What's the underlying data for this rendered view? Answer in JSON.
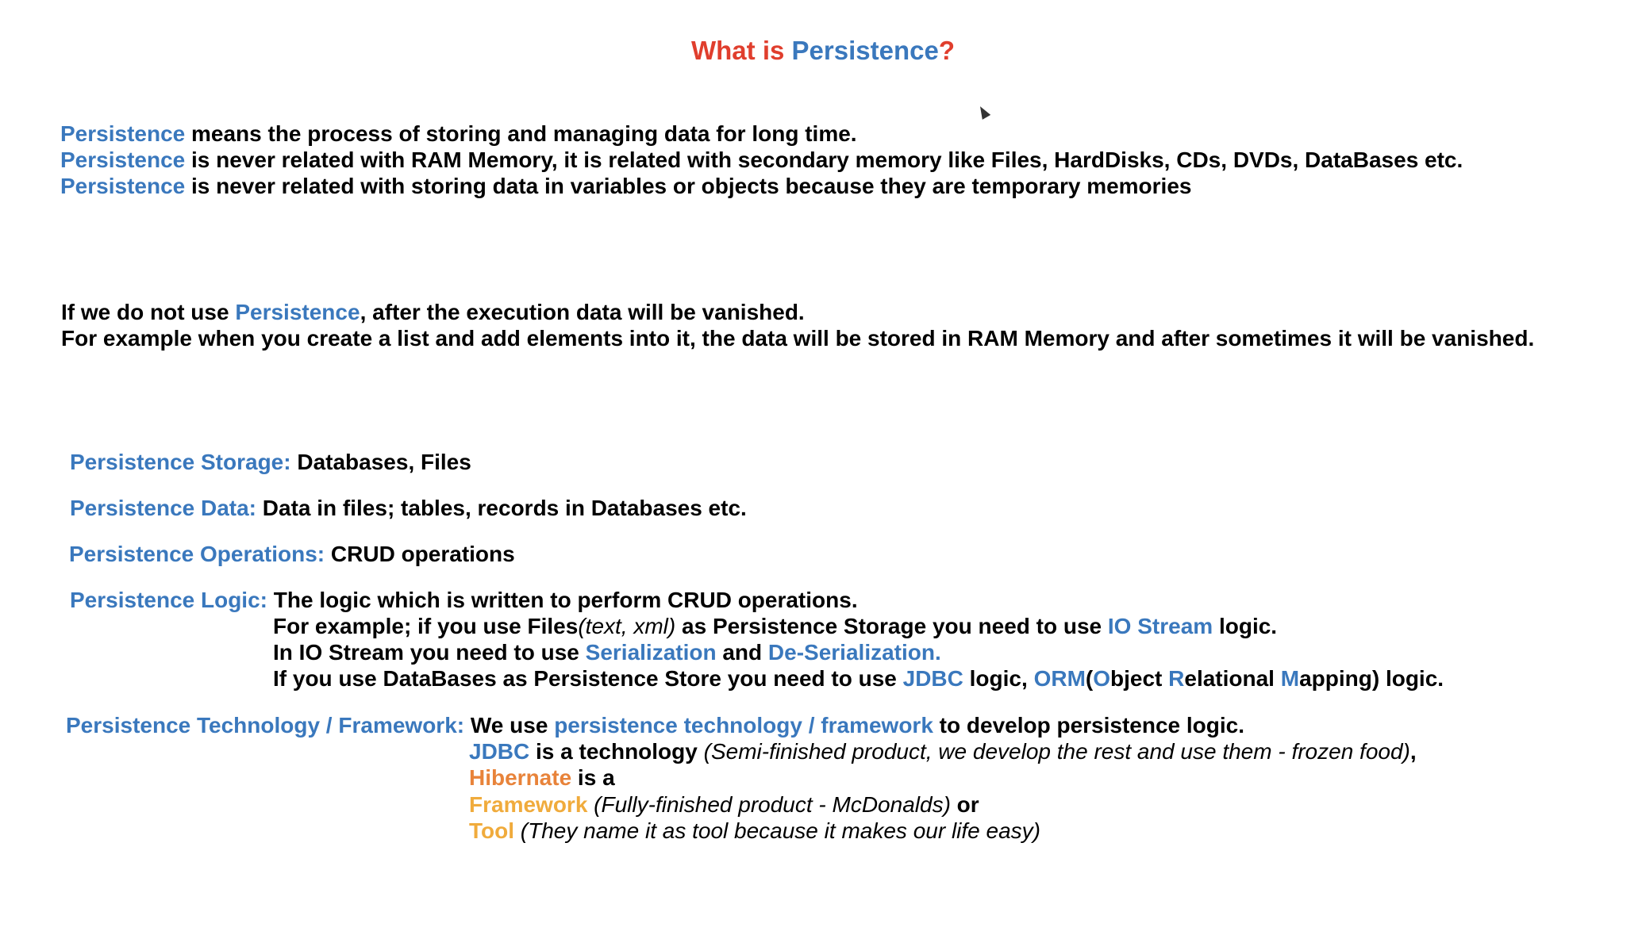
{
  "title": {
    "part1": "What is ",
    "part2": "Persistence",
    "part3": "?"
  },
  "definition": {
    "term": "Persistence",
    "line1": " means the process of storing and managing data for long time.",
    "line2": " is never related with RAM Memory, it is related with secondary memory like Files, HardDisks, CDs, DVDs, DataBases etc.",
    "line3": " is never related with storing data in variables or objects because they are temporary memories"
  },
  "consequence": {
    "line1_a": "If we do not use ",
    "line1_term": "Persistence",
    "line1_b": ", after the execution data will be vanished.",
    "line2": "For example when you create a list and add elements into it, the data will be stored in RAM Memory and after sometimes it will be vanished."
  },
  "concepts": {
    "storage_label": "Persistence Storage:",
    "storage_value": " Databases, Files",
    "data_label": "Persistence Data:",
    "data_value": " Data in files; tables, records in Databases etc.",
    "operations_label": "Persistence Operations:",
    "operations_value": " CRUD operations",
    "logic_label": "Persistence Logic:",
    "logic_value": " The logic which is written to perform CRUD operations.",
    "logic_example1_a": "For example; if you use Files",
    "logic_example1_italic": "(text, xml)",
    "logic_example1_b": " as Persistence Storage you need to use ",
    "logic_example1_term": "IO Stream",
    "logic_example1_c": " logic.",
    "logic_example2_a": "In IO Stream you need to use ",
    "logic_example2_term1": "Serialization",
    "logic_example2_b": " and ",
    "logic_example2_term2": "De-Serialization.",
    "logic_example3_a": "If you use DataBases as Persistence Store you need to use ",
    "logic_example3_term1": "JDBC",
    "logic_example3_b": " logic, ",
    "logic_example3_term2": "ORM",
    "logic_example3_c": "(",
    "logic_example3_o": "O",
    "logic_example3_d": "bject ",
    "logic_example3_r": "R",
    "logic_example3_e": "elational ",
    "logic_example3_m": "M",
    "logic_example3_f": "apping) logic."
  },
  "technology": {
    "label": "Persistence Technology / Framework:",
    "line1_a": " We use ",
    "line1_term": "persistence technology / framework",
    "line1_b": " to develop persistence logic.",
    "line2_term": "JDBC",
    "line2_a": " is a technology ",
    "line2_italic": "(Semi-finished product, we develop the rest and use them - frozen food)",
    "line2_b": ",",
    "line3_term": "Hibernate",
    "line3_a": " is a",
    "line4_term": "Framework",
    "line4_italic": " (Fully-finished product - McDonalds)",
    "line4_a": " or",
    "line5_term": "Tool",
    "line5_italic": " (They name it as tool because it makes our life easy)"
  },
  "colors": {
    "accent_blue": "#3a78bd",
    "title_red": "#e03e2d",
    "hibernate_orange": "#e8833a",
    "framework_gold": "#f0ab3c"
  },
  "icons": {
    "cursor": "mouse-pointer-icon"
  }
}
